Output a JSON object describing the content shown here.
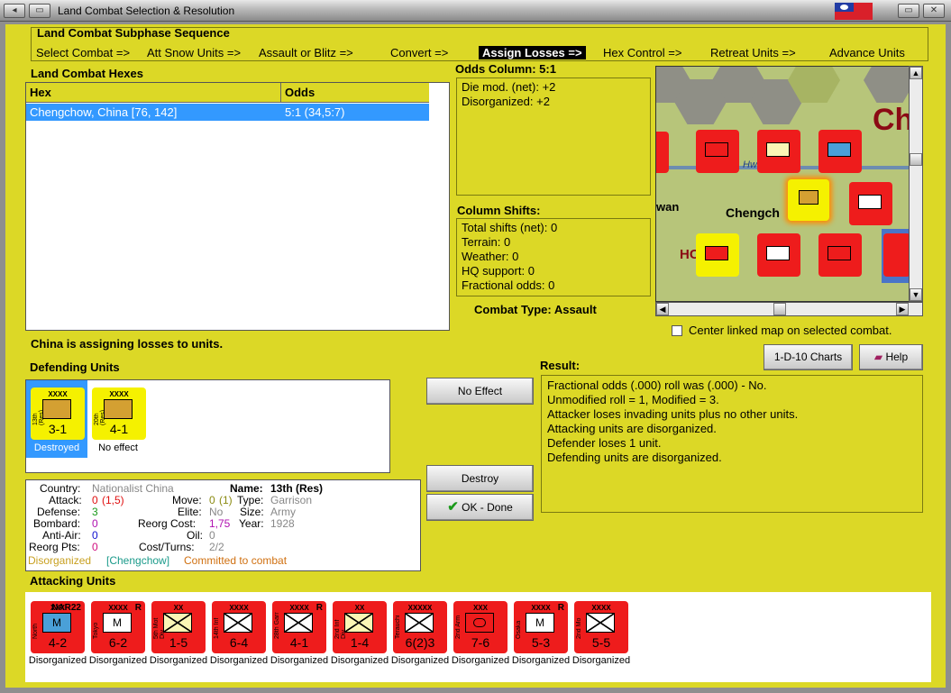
{
  "window": {
    "title": "Land Combat Selection & Resolution"
  },
  "sequence": {
    "heading": "Land Combat Subphase Sequence",
    "steps": [
      "Select Combat =>",
      "Att Snow Units =>",
      "Assault or Blitz =>",
      "Convert =>",
      "Assign Losses =>",
      "Hex Control =>",
      "Retreat Units =>",
      "Advance Units"
    ],
    "active_index": 4
  },
  "hexes": {
    "heading": "Land Combat Hexes",
    "col_hex": "Hex",
    "col_odds": "Odds",
    "rows": [
      {
        "hex": "Chengchow, China [76, 142]",
        "odds": "5:1 (34,5:7)"
      }
    ]
  },
  "odds_column": {
    "heading": "Odds Column: 5:1",
    "lines": [
      "Die mod. (net): +2",
      "Disorganized: +2"
    ]
  },
  "column_shifts": {
    "heading": "Column Shifts:",
    "lines": [
      "Total shifts (net): 0",
      "Terrain: 0",
      "Weather: 0",
      "HQ support: 0",
      "Fractional odds: 0"
    ]
  },
  "combat_type": "Combat Type:  Assault",
  "map": {
    "labels": [
      "Ch",
      "Chengch",
      "wan",
      "Hw",
      "HC"
    ],
    "center_checkbox": "Center linked map on selected combat."
  },
  "status_text": "China is assigning losses to units.",
  "defending": {
    "heading": "Defending Units",
    "units": [
      {
        "name": "13th (Res)",
        "size": "XXXX",
        "value": "3-1",
        "status": "Destroyed",
        "selected": true
      },
      {
        "name": "20th (Res)",
        "size": "XXXX",
        "value": "4-1",
        "status": "No effect",
        "selected": false
      }
    ]
  },
  "buttons": {
    "no_effect": "No Effect",
    "destroy": "Destroy",
    "ok_done": "OK - Done",
    "charts": "1-D-10 Charts",
    "help": "Help"
  },
  "result": {
    "heading": "Result:",
    "lines": [
      "Fractional odds (.000) roll was (.000)  - No.",
      "Unmodified roll = 1, Modified = 3.",
      "Attacker loses invading units plus no other units.",
      "Attacking units are disorganized.",
      "Defender loses 1 unit.",
      "Defending units are disorganized."
    ]
  },
  "details": {
    "country_label": "Country:",
    "country": "Nationalist China",
    "name_label": "Name:",
    "name": "13th (Res)",
    "attack_label": "Attack:",
    "attack": "0",
    "attack_extra": "(1,5)",
    "move_label": "Move:",
    "move": "0",
    "move_extra": "(1)",
    "type_label": "Type:",
    "type": "Garrison",
    "defense_label": "Defense:",
    "defense": "3",
    "elite_label": "Elite:",
    "elite": "No",
    "size_label": "Size:",
    "size": "Army",
    "bombard_label": "Bombard:",
    "bombard": "0",
    "reorg_label": "Reorg Cost:",
    "reorg": "1,75",
    "year_label": "Year:",
    "year": "1928",
    "antiair_label": "Anti-Air:",
    "antiair": "0",
    "oil_label": "Oil:",
    "oil": "0",
    "reorgpts_label": "Reorg Pts:",
    "reorgpts": "0",
    "cost_label": "Cost/Turns:",
    "cost": "2/2",
    "status1": "Disorganized",
    "status2": "[Chengchow]",
    "status3": "Committed to combat"
  },
  "attacking": {
    "heading": "Attacking Units",
    "units": [
      {
        "name": "North",
        "size": "XXX",
        "value": "4-2",
        "symbol": "M",
        "status": "Disorganized",
        "blue": true,
        "r": "NAR22"
      },
      {
        "name": "Tokyo",
        "size": "XXXX",
        "value": "6-2",
        "symbol": "M",
        "status": "Disorganized",
        "blue": false,
        "r": "R"
      },
      {
        "name": "5th Mot Div",
        "size": "XX",
        "value": "1-5",
        "symbol": "X",
        "status": "Disorganized",
        "blue": false,
        "r": ""
      },
      {
        "name": "14th Inf",
        "size": "XXXX",
        "value": "6-4",
        "symbol": "X",
        "status": "Disorganized",
        "blue": false,
        "r": ""
      },
      {
        "name": "28th Garr",
        "size": "XXXX",
        "value": "4-1",
        "symbol": "G",
        "status": "Disorganized",
        "blue": false,
        "r": "R"
      },
      {
        "name": "2nd Inf Div",
        "size": "XX",
        "value": "1-4",
        "symbol": "X",
        "status": "Disorganized",
        "blue": false,
        "r": ""
      },
      {
        "name": "Terauchi",
        "size": "XXXXX",
        "value": "6(2)3",
        "symbol": "X",
        "status": "Disorganized",
        "blue": false,
        "r": ""
      },
      {
        "name": "2nd Arm",
        "size": "XXX",
        "value": "7-6",
        "symbol": "A",
        "status": "Disorganized",
        "blue": false,
        "r": ""
      },
      {
        "name": "Osaka",
        "size": "XXXX",
        "value": "5-3",
        "symbol": "M",
        "status": "Disorganized",
        "blue": false,
        "r": "R"
      },
      {
        "name": "2nd Mo",
        "size": "XXXX",
        "value": "5-5",
        "symbol": "X",
        "status": "Disorganized",
        "blue": false,
        "r": ""
      }
    ]
  },
  "colors": {
    "panel": "#dcd826",
    "selection": "#3399ff",
    "unit_red": "#ee1c1c",
    "unit_yellow": "#f5f100"
  }
}
